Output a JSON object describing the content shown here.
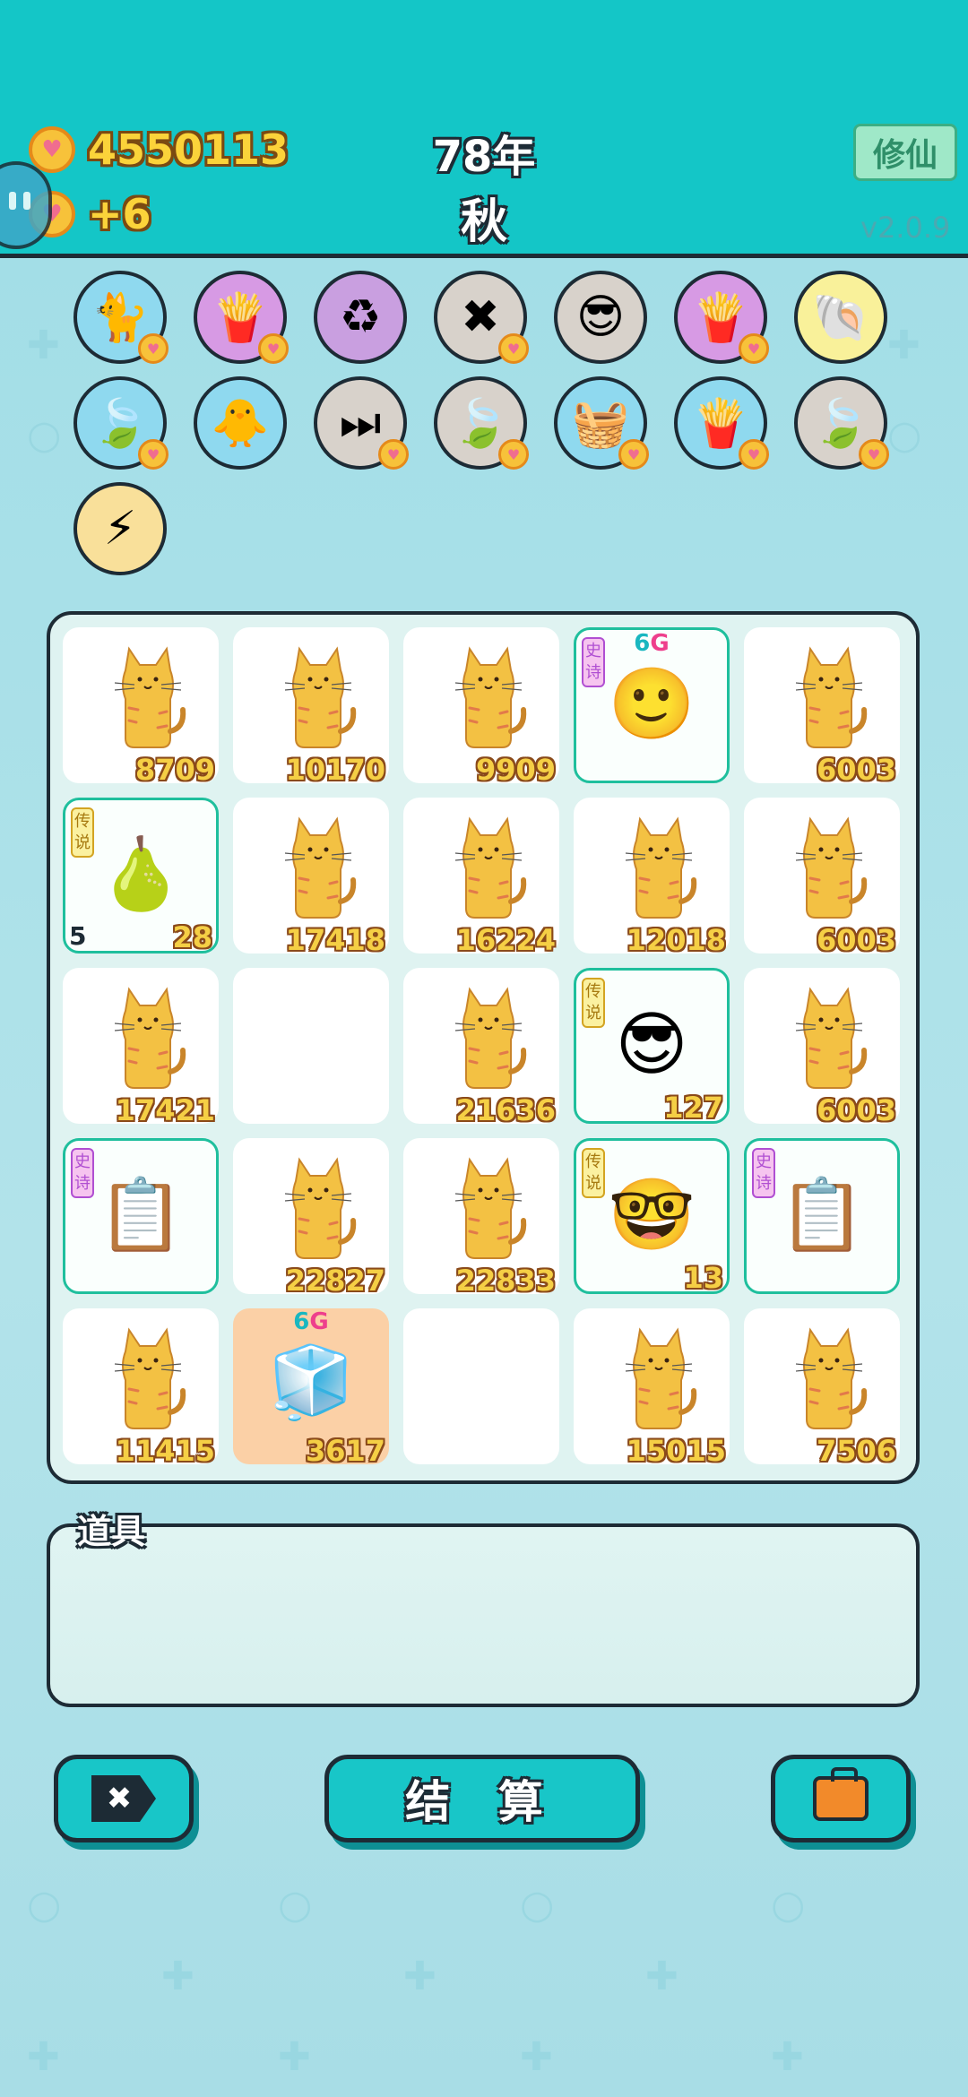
{
  "header": {
    "coins": "4550113",
    "coin_rate": "+6",
    "year": "78年",
    "season": "秋",
    "xiuxian_label": "修仙",
    "version": "v2.0.9"
  },
  "relics": [
    {
      "icon": "cat-photo-icon",
      "color": "#8fd9ef",
      "glyph": "🐈",
      "heart": true
    },
    {
      "icon": "fries-icon",
      "color": "#d79ae4",
      "glyph": "🍟",
      "heart": true
    },
    {
      "icon": "recycle-icon",
      "color": "#c99fe0",
      "glyph": "♻",
      "heart": false
    },
    {
      "icon": "delete-tag-icon",
      "color": "#d8d2cb",
      "glyph": "✖",
      "heart": true
    },
    {
      "icon": "cat-sunglasses-icon",
      "color": "#d8d2cb",
      "glyph": "😎",
      "heart": false
    },
    {
      "icon": "fries-icon",
      "color": "#d79ae4",
      "glyph": "🍟",
      "heart": true
    },
    {
      "icon": "shell-icon",
      "color": "#f9f19a",
      "glyph": "🐚",
      "heart": false
    },
    {
      "icon": "leaf-icon",
      "color": "#8fd9ef",
      "glyph": "🍃",
      "heart": true
    },
    {
      "icon": "chick-egg-icon",
      "color": "#8fd9ef",
      "glyph": "🐥",
      "heart": false
    },
    {
      "icon": "skip-icon",
      "color": "#d8d2cb",
      "glyph": "⏭",
      "heart": true
    },
    {
      "icon": "leaf-icon",
      "color": "#d8d2cb",
      "glyph": "🍃",
      "heart": true
    },
    {
      "icon": "fruit-basket-icon",
      "color": "#8fd9ef",
      "glyph": "🧺",
      "heart": true
    },
    {
      "icon": "fries-icon",
      "color": "#8fd9ef",
      "glyph": "🍟",
      "heart": true
    },
    {
      "icon": "leaf-icon",
      "color": "#d8d2cb",
      "glyph": "🍃",
      "heart": true
    },
    {
      "icon": "lightning-icon",
      "color": "#f9e09a",
      "glyph": "⚡",
      "heart": false
    }
  ],
  "grid": [
    [
      {
        "type": "cat",
        "value": "8709"
      },
      {
        "type": "cat",
        "value": "10170"
      },
      {
        "type": "cat",
        "value": "9909"
      },
      {
        "type": "face-red-hat",
        "tag": "史诗",
        "tier": "epic",
        "sixg": "6G",
        "glyph": "🙂",
        "value": ""
      },
      {
        "type": "cat",
        "value": "6003"
      }
    ],
    [
      {
        "type": "gourd",
        "tag": "传说",
        "tier": "legend",
        "glyph": "🍐",
        "value": "28",
        "left": "5"
      },
      {
        "type": "cat",
        "value": "17418"
      },
      {
        "type": "cat",
        "value": "16224"
      },
      {
        "type": "cat",
        "value": "12018"
      },
      {
        "type": "cat",
        "value": "6003"
      }
    ],
    [
      {
        "type": "cat",
        "value": "17421"
      },
      {
        "type": "empty"
      },
      {
        "type": "cat",
        "value": "21636"
      },
      {
        "type": "face-sunglasses",
        "tag": "传说",
        "tier": "legend",
        "glyph": "😎",
        "value": "127"
      },
      {
        "type": "cat",
        "value": "6003"
      }
    ],
    [
      {
        "type": "copy-paste",
        "tag": "史诗",
        "tier": "epic",
        "glyph": "📋",
        "value": ""
      },
      {
        "type": "cat",
        "value": "22827"
      },
      {
        "type": "cat",
        "value": "22833"
      },
      {
        "type": "face-king",
        "tag": "传说",
        "tier": "legend",
        "glyph": "🤓",
        "value": "13"
      },
      {
        "type": "copy-paste",
        "tag": "史诗",
        "tier": "epic",
        "glyph": "📋",
        "value": ""
      }
    ],
    [
      {
        "type": "cat",
        "value": "11415"
      },
      {
        "type": "fridge",
        "sixg": "6G",
        "glyph": "🧊",
        "value": "3617",
        "peach": true
      },
      {
        "type": "empty"
      },
      {
        "type": "cat",
        "value": "15015"
      },
      {
        "type": "cat",
        "value": "7506"
      }
    ]
  ],
  "tools": {
    "label": "道具"
  },
  "buttons": {
    "settle_label": "结 算",
    "delete_glyph": "✖"
  }
}
